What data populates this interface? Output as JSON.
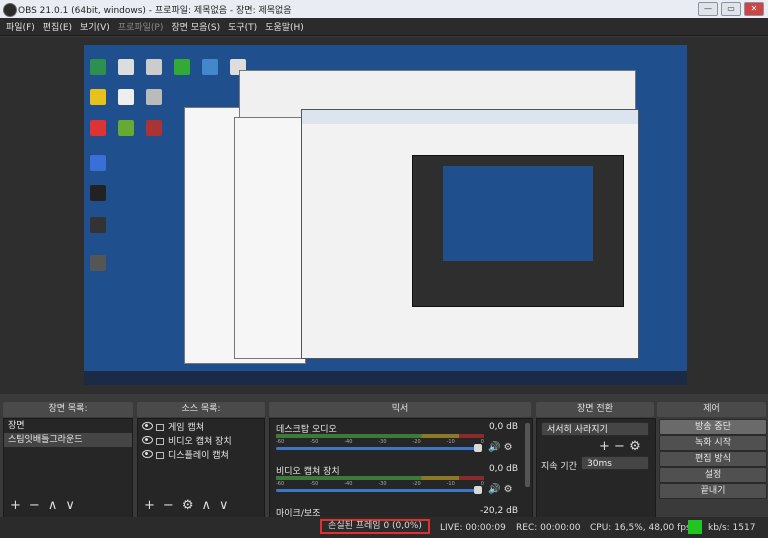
{
  "window": {
    "title": "OBS 21.0.1 (64bit, windows) - 프로파일: 제목없음 - 장면: 제목없음"
  },
  "menu": [
    "파일(F)",
    "편집(E)",
    "보기(V)",
    "프로파일(P)",
    "장면 모음(S)",
    "도구(T)",
    "도움말(H)"
  ],
  "panels": {
    "scenes": {
      "title": "장면 목록:",
      "items": [
        "장면",
        "스팀잇배틀그라운드"
      ]
    },
    "sources": {
      "title": "소스 목록:",
      "items": [
        "게임 캡쳐",
        "비디오 캡쳐 장치",
        "디스플레이 캡쳐"
      ]
    },
    "mixer": {
      "title": "믹서",
      "channels": [
        {
          "name": "데스크탑 오디오",
          "db": "0,0 dB"
        },
        {
          "name": "비디오 캡쳐 장치",
          "db": "0,0 dB"
        },
        {
          "name": "마이크/보조",
          "db": "-20,2 dB"
        }
      ]
    },
    "transitions": {
      "title": "장면 전환",
      "selected": "서서히 사라지기",
      "duration_label": "지속 기간",
      "duration_value": "30ms"
    },
    "controls": {
      "title": "제어",
      "buttons": [
        "방송 중단",
        "녹화 시작",
        "편집 방식",
        "설정",
        "끝내기"
      ]
    }
  },
  "status": {
    "dropped_frames": "손실된 프레임 0 (0,0%)",
    "live": "LIVE: 00:00:09",
    "rec": "REC: 00:00:00",
    "cpu": "CPU: 16,5%, 48,00 fps",
    "kbps": "kb/s: 1517",
    "indicator_color": "#21c521",
    "dropped_border_color": "#e03030"
  },
  "icons": [
    "eye-icon",
    "lock-icon",
    "plus-icon",
    "minus-icon",
    "gear-icon",
    "up-arrow-icon",
    "down-arrow-icon",
    "speaker-icon"
  ]
}
